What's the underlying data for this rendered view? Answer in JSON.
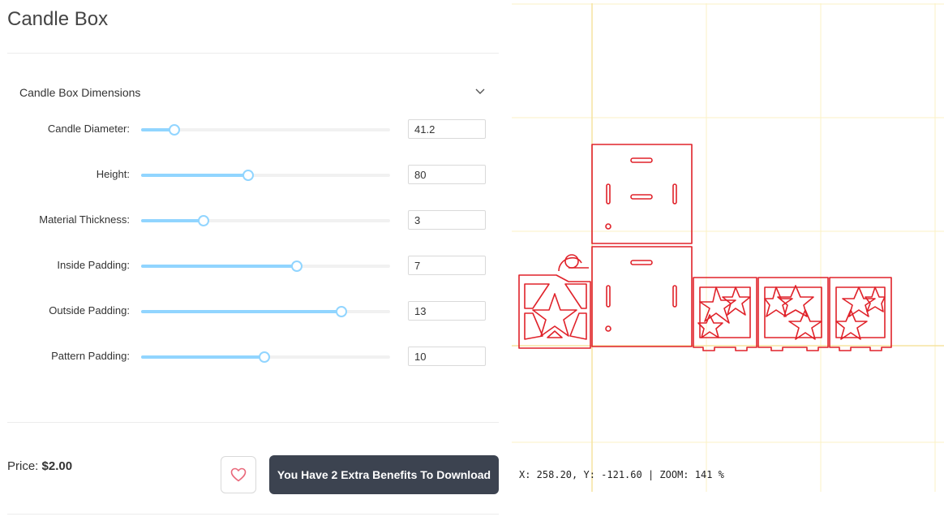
{
  "page": {
    "title": "Candle Box"
  },
  "section": {
    "title": "Candle Box Dimensions"
  },
  "params": [
    {
      "label": "Candle Diameter:",
      "value": "41.2",
      "fraction": 0.135
    },
    {
      "label": "Height:",
      "value": "80",
      "fraction": 0.43
    },
    {
      "label": "Material Thickness:",
      "value": "3",
      "fraction": 0.25
    },
    {
      "label": "Inside Padding:",
      "value": "7",
      "fraction": 0.625
    },
    {
      "label": "Outside Padding:",
      "value": "13",
      "fraction": 0.805
    },
    {
      "label": "Pattern Padding:",
      "value": "10",
      "fraction": 0.495
    }
  ],
  "footer": {
    "price_label": "Price: ",
    "price_value": "$2.00",
    "download_label": "You Have 2 Extra Benefits To Download"
  },
  "preview": {
    "status": "X: 258.20, Y: -121.60 | ZOOM: 141 %",
    "stroke_color": "#e0222a",
    "grid_color": "#fbf2c4"
  },
  "icons": {
    "collapse": "chevron-down-icon",
    "favorite": "heart-icon"
  },
  "colors": {
    "slider_accent": "#91d5ff",
    "button_dark": "#3c4350",
    "favorite_icon": "#e9687a"
  }
}
